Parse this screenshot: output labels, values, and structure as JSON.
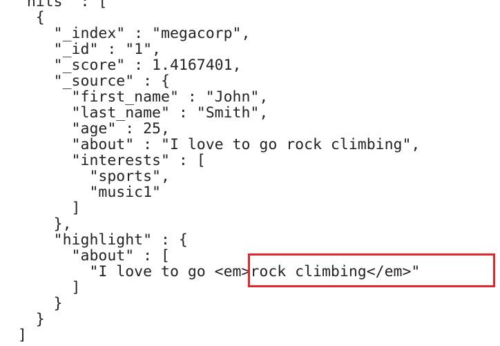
{
  "json_view": {
    "lines": [
      "  \"hits\" : [",
      "    {",
      "      \"_index\" : \"megacorp\",",
      "      \"_id\" : \"1\",",
      "      \"_score\" : 1.4167401,",
      "      \"_source\" : {",
      "        \"first_name\" : \"John\",",
      "        \"last_name\" : \"Smith\",",
      "        \"age\" : 25,",
      "        \"about\" : \"I love to go rock climbing\",",
      "        \"interests\" : [",
      "          \"sports\",",
      "          \"music1\"",
      "        ]",
      "      },",
      "      \"highlight\" : {",
      "        \"about\" : [",
      "          \"I love to go <em>rock climbing</em>\"",
      "        ]",
      "      }",
      "    }",
      "  ]"
    ],
    "annotation": {
      "color": "#e3262b",
      "target_text": "<em>rock climbing</em>\""
    }
  }
}
